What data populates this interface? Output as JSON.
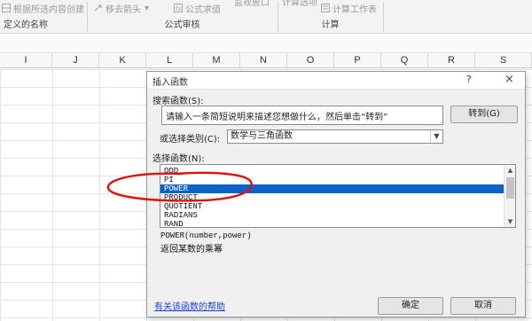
{
  "ribbon": {
    "items": [
      {
        "label": "根据所选内容创建"
      },
      {
        "label": "移去箭头"
      },
      {
        "label": "公式求值"
      },
      {
        "label": "监视窗口"
      },
      {
        "label": "计算选项"
      },
      {
        "label": "计算工作表"
      }
    ],
    "groups": [
      {
        "label": "定义的名称"
      },
      {
        "label": "公式审核"
      },
      {
        "label": "计算"
      }
    ]
  },
  "columns": [
    "I",
    "J",
    "K",
    "L",
    "M",
    "N",
    "O",
    "P",
    "Q",
    "R",
    "S"
  ],
  "dialog": {
    "title": "插入函数",
    "help_glyph": "?",
    "close_glyph": "×",
    "search_label": "搜索函数(S):",
    "search_value": "请输入一条简短说明来描述您想做什么，然后单击“转到”",
    "goto_button": "转到(G)",
    "category_label": "或选择类别(C):",
    "category_value": "数学与三角函数",
    "function_list_label": "选择函数(N):",
    "functions": [
      "ODD",
      "PI",
      "POWER",
      "PRODUCT",
      "QUOTIENT",
      "RADIANS",
      "RAND"
    ],
    "selected_function": "POWER",
    "syntax": "POWER(number,power)",
    "description": "返回某数的乘幂",
    "help_link": "有关该函数的帮助",
    "ok_button": "确定",
    "cancel_button": "取消"
  },
  "annotation": {
    "color": "#e01010"
  }
}
